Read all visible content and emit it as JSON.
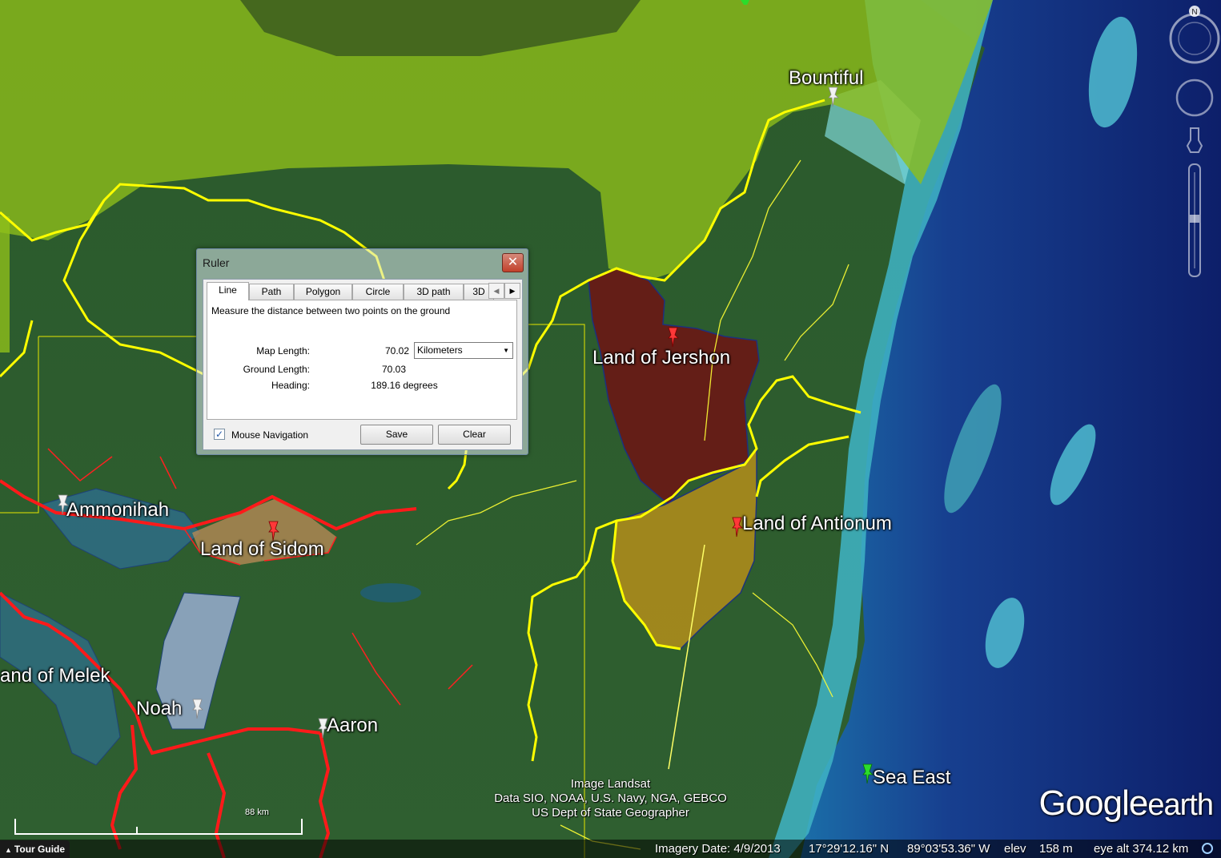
{
  "placemarks": [
    {
      "label": "Bountiful"
    },
    {
      "label": "Land of Jershon"
    },
    {
      "label": "Land of Antionum"
    },
    {
      "label": "Ammonihah"
    },
    {
      "label": "Land of Sidom"
    },
    {
      "label": "and of Melek"
    },
    {
      "label": "Noah"
    },
    {
      "label": "Aaron"
    },
    {
      "label": "Sea East"
    }
  ],
  "ruler": {
    "title": "Ruler",
    "close_label": "✕",
    "tabs": [
      "Line",
      "Path",
      "Polygon",
      "Circle",
      "3D path",
      "3D"
    ],
    "active_tab": "Line",
    "description": "Measure the distance between two points on the ground",
    "map_length_label": "Map Length:",
    "map_length_value": "70.02",
    "ground_length_label": "Ground Length:",
    "ground_length_value": "70.03",
    "heading_label": "Heading:",
    "heading_value": "189.16 degrees",
    "unit_selected": "Kilometers",
    "mouse_navigation_label": "Mouse Navigation",
    "mouse_navigation_checked": true,
    "save_label": "Save",
    "clear_label": "Clear"
  },
  "attribution": {
    "lines": [
      "Image Landsat",
      "Data SIO, NOAA, U.S. Navy, NGA, GEBCO",
      "US Dept of State Geographer"
    ]
  },
  "logo": {
    "google": "Google",
    "earth": "earth"
  },
  "scale": {
    "label": "88 km"
  },
  "status": {
    "tour_guide": "Tour Guide",
    "imagery_date": "Imagery Date: 4/9/2013",
    "latitude": "17°29'12.16\" N",
    "longitude": "89°03'53.36\" W",
    "elev_label": "elev",
    "elev_value": "158 m",
    "eye_alt": "eye alt 374.12 km"
  },
  "colors": {
    "jershon_fill": "#6e1414",
    "antionum_fill": "#b8901a",
    "sidom_fill": "#b58a55",
    "border_yellow": "#ffff00",
    "border_red": "#ff1a1a"
  }
}
